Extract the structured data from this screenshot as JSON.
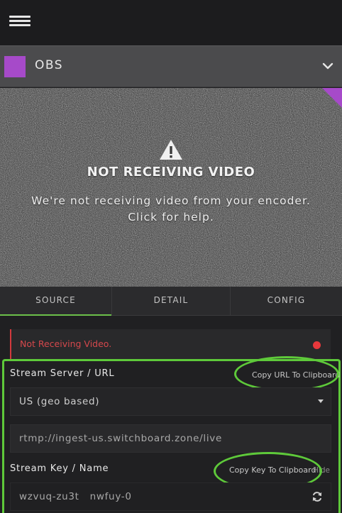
{
  "header": {
    "menu_icon": "hamburger-menu-icon"
  },
  "source_selector": {
    "name": "OBS",
    "swatch_color": "#a64ac9",
    "chevron_icon": "chevron-down-icon"
  },
  "video": {
    "warning_icon": "warning-triangle-icon",
    "headline": "NOT RECEIVING VIDEO",
    "message_line1": "We're not receiving video from your encoder.",
    "message_line2": "Click for help."
  },
  "tabs": [
    {
      "label": "SOURCE",
      "active": true
    },
    {
      "label": "DETAIL",
      "active": false
    },
    {
      "label": "CONFIG",
      "active": false
    }
  ],
  "status": {
    "text": "Not Receiving Video.",
    "indicator_color": "#e8383c"
  },
  "stream_server": {
    "label": "Stream Server / URL",
    "copy_label": "Copy URL To Clipboard",
    "region_value": "US (geo based)",
    "url_value": "rtmp://ingest-us.switchboard.zone/live"
  },
  "stream_key": {
    "label": "Stream Key / Name",
    "copy_label": "Copy Key To Clipboard",
    "hide_label": "Hide",
    "value": "wzvuq-zu3t   nwfuy-0",
    "refresh_icon": "refresh-icon"
  },
  "colors": {
    "accent_green": "#5ec93a",
    "brand_purple": "#a64ac9",
    "error_red": "#d5484c"
  }
}
